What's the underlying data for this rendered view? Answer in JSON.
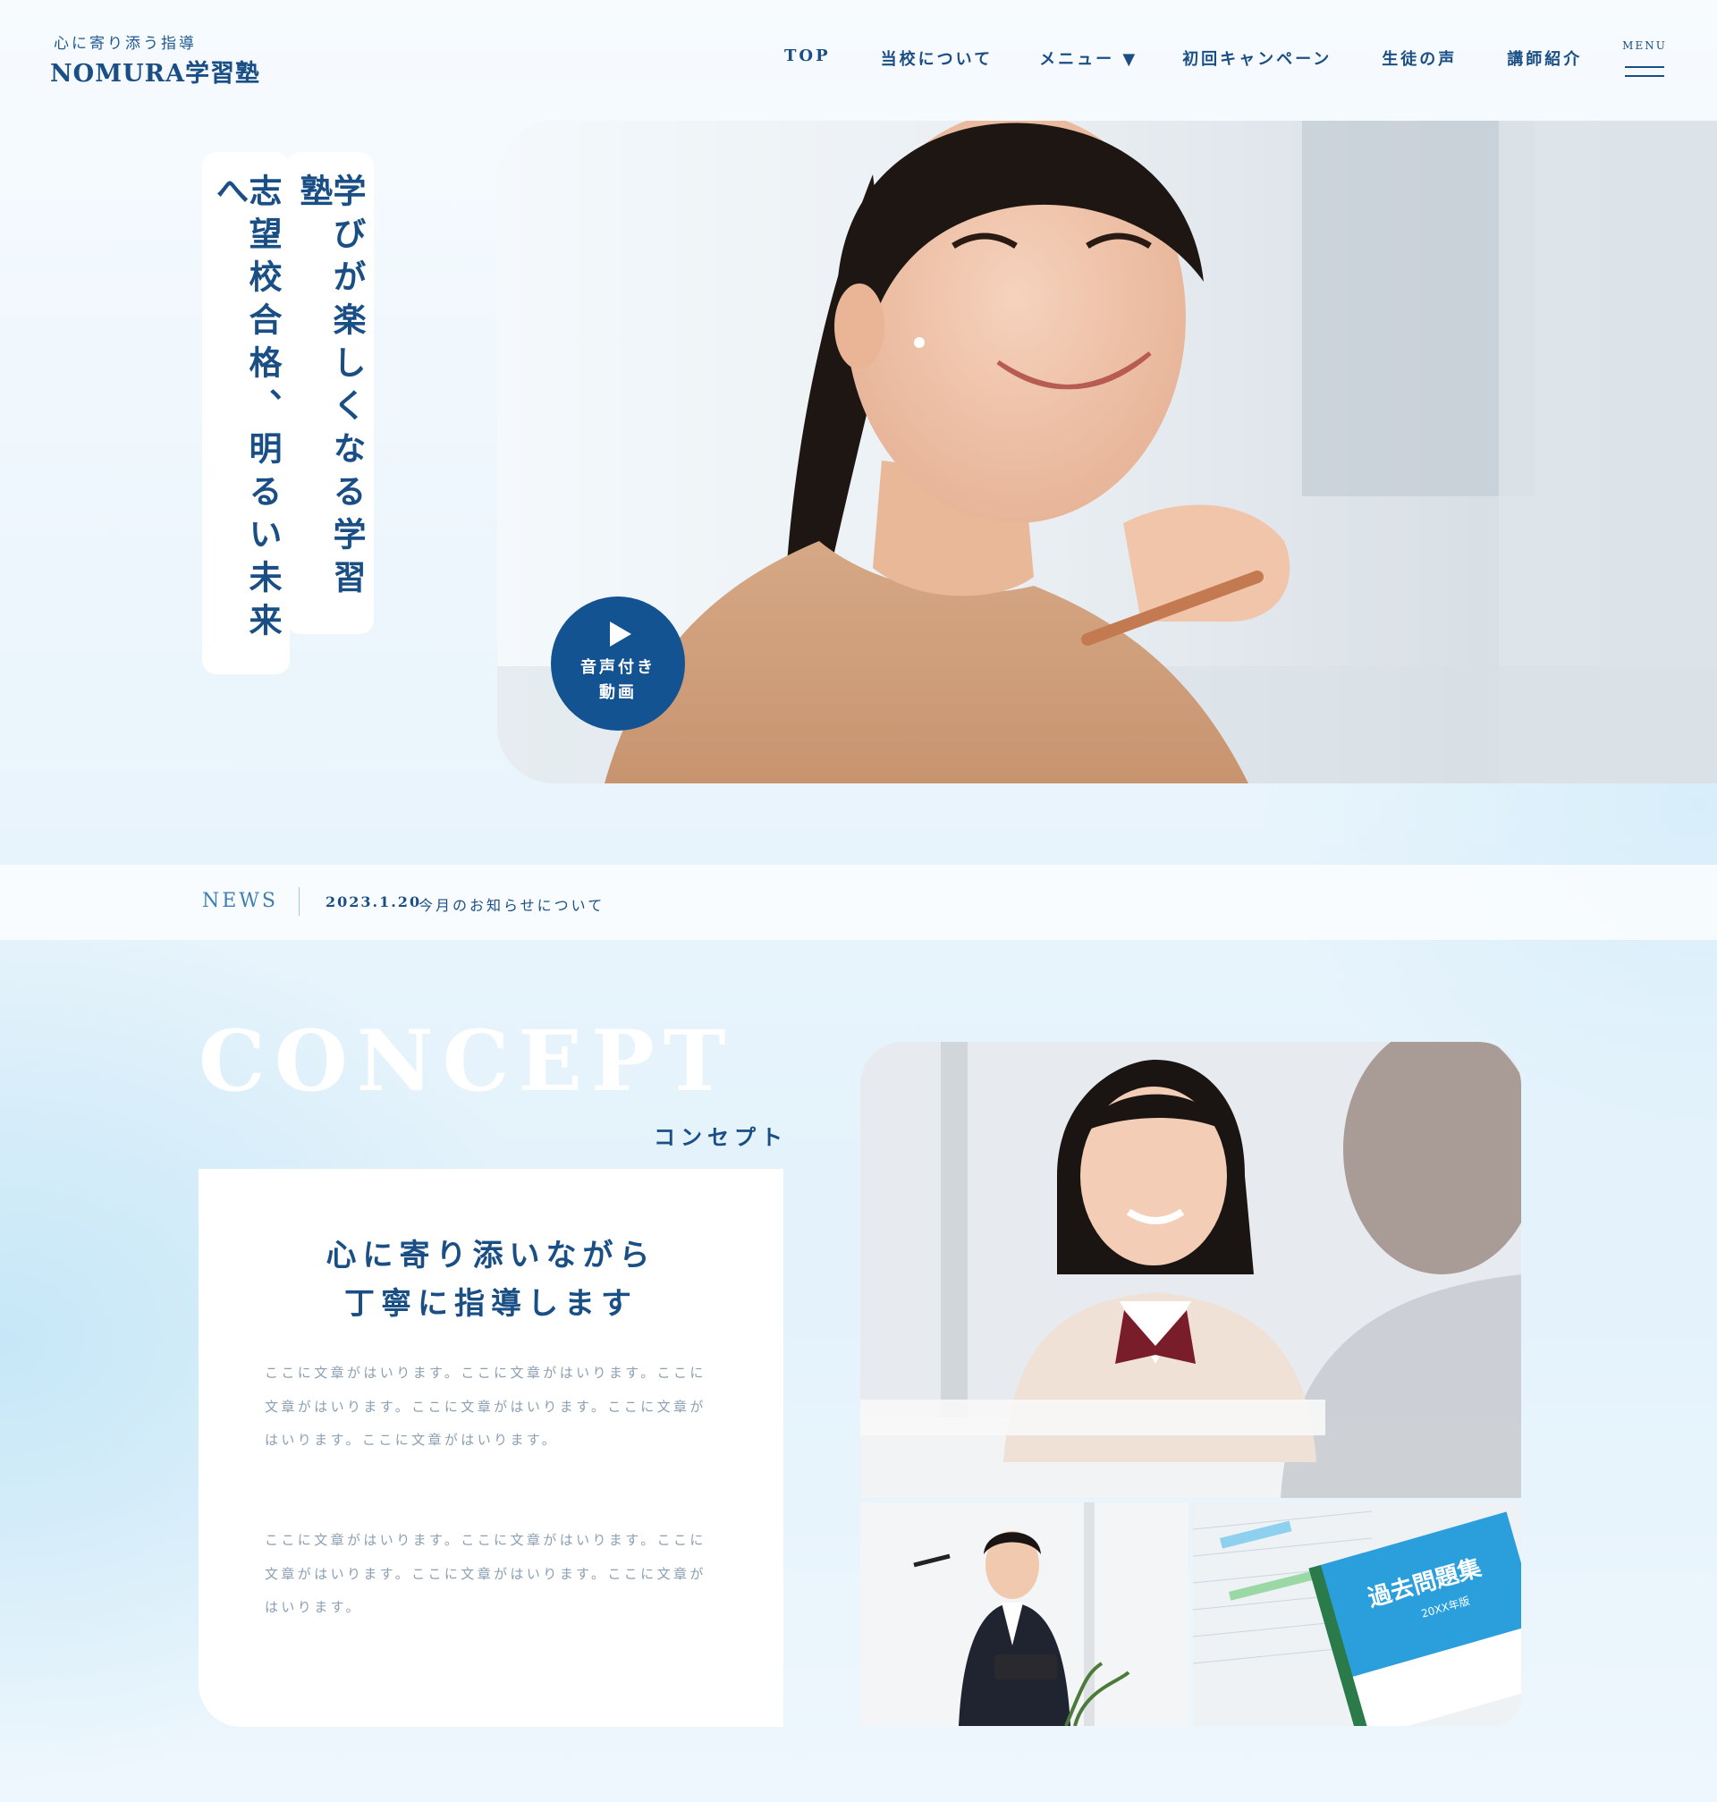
{
  "header": {
    "tagline": "心に寄り添う指導",
    "logo": "NOMURA学習塾",
    "nav": [
      {
        "label": "TOP"
      },
      {
        "label": "当校について"
      },
      {
        "label": "メニュー ▼"
      },
      {
        "label": "初回キャンペーン"
      },
      {
        "label": "生徒の声"
      },
      {
        "label": "講師紹介"
      }
    ],
    "menu_label": "MENU"
  },
  "hero": {
    "catch_1": "学びが楽しくなる学習塾",
    "catch_2": "志望校合格、明るい未来へ",
    "video_button_line1": "音声付き",
    "video_button_line2": "動画"
  },
  "news": {
    "label": "NEWS",
    "date": "2023.1.20",
    "title": "今月のお知らせについて"
  },
  "concept": {
    "title_en": "CONCEPT",
    "title_ja": "コンセプト",
    "heading_line1": "心に寄り添いながら",
    "heading_line2": "丁寧に指導します",
    "paragraph_1": "ここに文章がはいります。ここに文章がはいります。ここに文章がはいります。ここに文章がはいります。ここに文章がはいります。ここに文章がはいります。",
    "paragraph_2": "ここに文章がはいります。ここに文章がはいります。ここに文章がはいります。ここに文章がはいります。ここに文章がはいります。",
    "book_title": "過去問題集",
    "book_year": "20XX年版"
  },
  "colors": {
    "primary": "#1a4f86",
    "button": "#135391",
    "muted_text": "#8a9fb3"
  }
}
